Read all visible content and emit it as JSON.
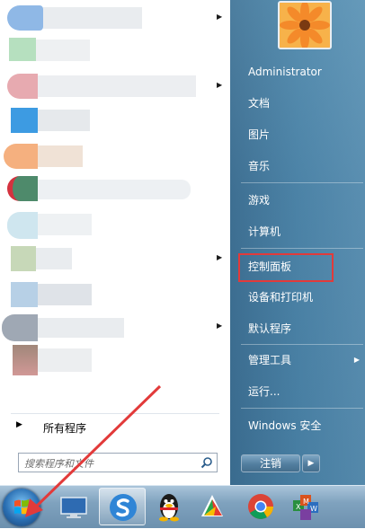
{
  "left": {
    "all_programs": "所有程序",
    "search_placeholder": "搜索程序和文件"
  },
  "right": {
    "items": [
      {
        "label": "Administrator"
      },
      {
        "label": "文档"
      },
      {
        "label": "图片"
      },
      {
        "label": "音乐"
      },
      {
        "label": "游戏"
      },
      {
        "label": "计算机"
      },
      {
        "label": "控制面板"
      },
      {
        "label": "设备和打印机"
      },
      {
        "label": "默认程序"
      },
      {
        "label": "管理工具"
      },
      {
        "label": "运行..."
      },
      {
        "label": "Windows 安全"
      }
    ],
    "shutdown_label": "注销"
  },
  "taskbar": {
    "icons": [
      "start-orb-icon",
      "desktop-monitor-icon",
      "sogou-icon",
      "qq-penguin-icon",
      "security-guard-icon",
      "chrome-icon",
      "office-icon"
    ]
  },
  "colors": {
    "highlight_border": "#e23a3a",
    "annotation_arrow": "#e23a3a"
  }
}
